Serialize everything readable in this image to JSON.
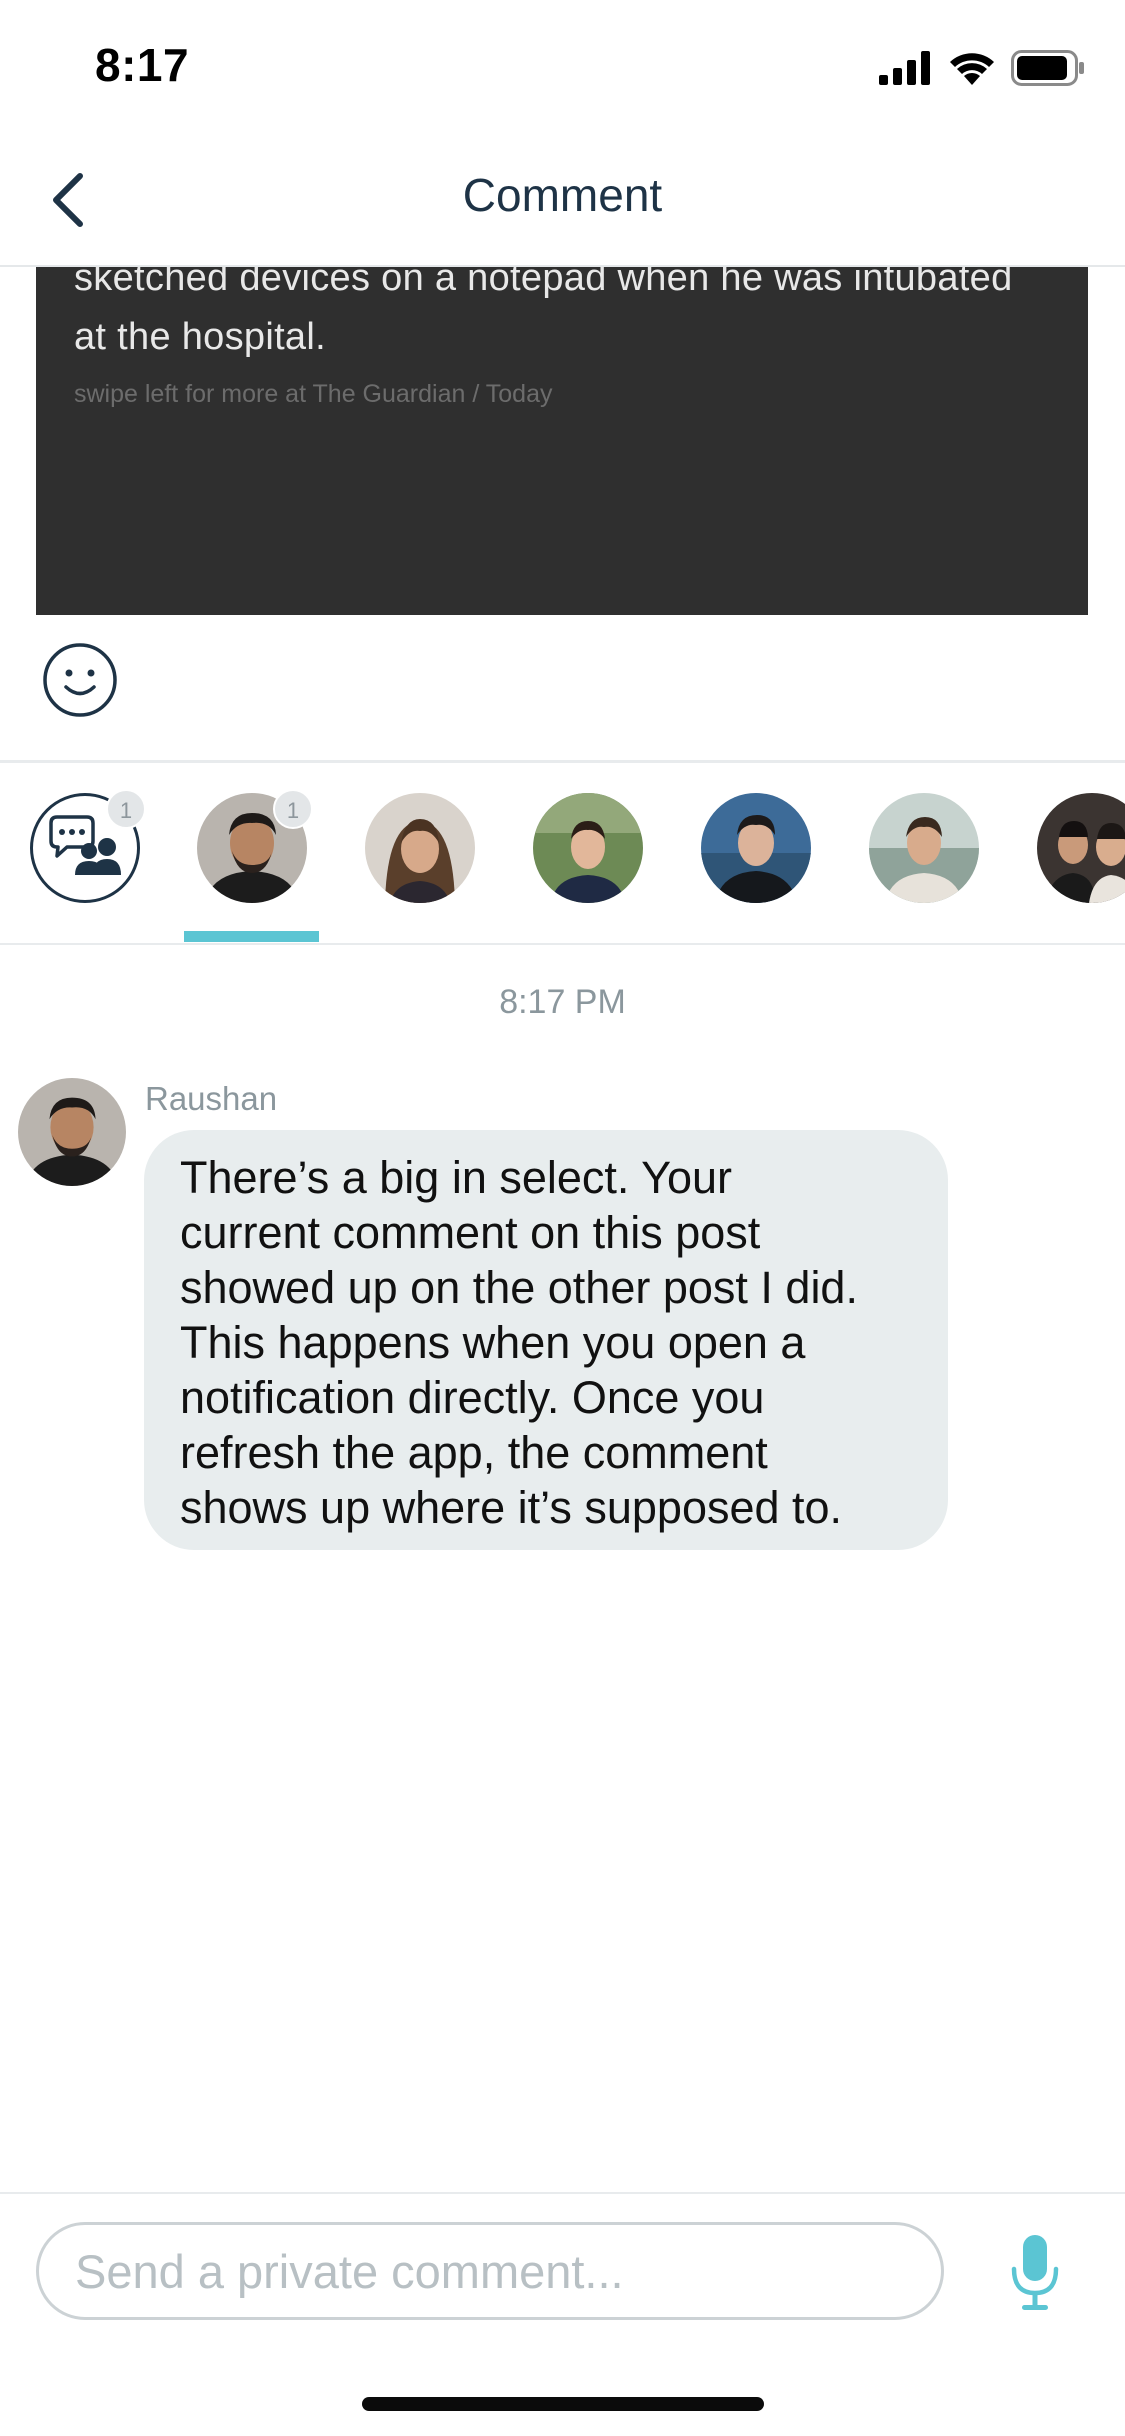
{
  "status_bar": {
    "time": "8:17",
    "icons": [
      "signal-icon",
      "wifi-icon",
      "battery-icon"
    ]
  },
  "nav": {
    "back_icon": "chevron-left-icon",
    "title": "Comment"
  },
  "article": {
    "text": "sketched devices on a notepad when he was intubated at the hospital.",
    "source": "swipe left for more at The Guardian / Today"
  },
  "emoji_icon": "smiley-face-icon",
  "participants": [
    {
      "type": "group",
      "icon": "group-chat-icon",
      "badge": "1",
      "active": false
    },
    {
      "type": "person",
      "badge": "1",
      "active": true
    },
    {
      "type": "person",
      "active": false
    },
    {
      "type": "person",
      "active": false
    },
    {
      "type": "person",
      "active": false
    },
    {
      "type": "person",
      "active": false
    },
    {
      "type": "person",
      "active": false
    }
  ],
  "conversation": {
    "timestamp": "8:17 PM",
    "messages": [
      {
        "sender": "Raushan",
        "lines": [
          "There’s a big in select. Your",
          "current comment on this post",
          "showed up on the other post I did.",
          "This happens when you open a",
          "notification directly. Once you",
          "refresh the app, the comment",
          "shows up where it’s supposed to."
        ]
      }
    ]
  },
  "composer": {
    "placeholder": "Send a private comment...",
    "value": "",
    "mic_icon": "microphone-icon"
  },
  "colors": {
    "accent": "#5bc5d3",
    "title": "#1e3346",
    "bubble": "#e8edee",
    "card": "#2f2f2f",
    "muted": "#8b979d"
  }
}
